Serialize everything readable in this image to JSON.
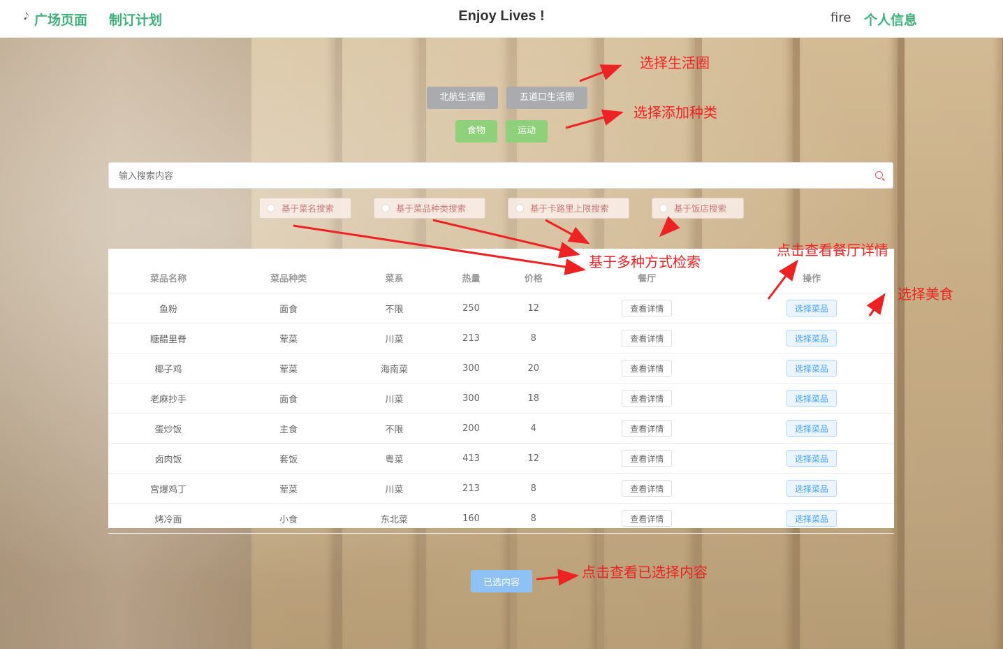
{
  "nav": {
    "plaza_label": "广场页面",
    "plan_label": "制订计划",
    "brand": "Enjoy Lives !",
    "username": "fire",
    "profile_label": "个人信息"
  },
  "circles": [
    {
      "label": "北航生活圈"
    },
    {
      "label": "五道口生活圈"
    }
  ],
  "categories": [
    {
      "label": "食物"
    },
    {
      "label": "运动"
    }
  ],
  "search": {
    "placeholder": "输入搜索内容"
  },
  "search_modes": [
    {
      "label": "基于菜名搜索"
    },
    {
      "label": "基于菜品种类搜索"
    },
    {
      "label": "基于卡路里上限搜索"
    },
    {
      "label": "基于饭店搜索"
    }
  ],
  "table": {
    "headers": [
      "菜品名称",
      "菜品种类",
      "菜系",
      "热量",
      "价格",
      "餐厅",
      "操作"
    ],
    "detail_label": "查看详情",
    "select_label": "选择菜品",
    "rows": [
      [
        "鱼粉",
        "面食",
        "不限",
        "250",
        "12"
      ],
      [
        "糖醋里脊",
        "荤菜",
        "川菜",
        "213",
        "8"
      ],
      [
        "椰子鸡",
        "荤菜",
        "海南菜",
        "300",
        "20"
      ],
      [
        "老麻抄手",
        "面食",
        "川菜",
        "300",
        "18"
      ],
      [
        "蛋炒饭",
        "主食",
        "不限",
        "200",
        "4"
      ],
      [
        "卤肉饭",
        "套饭",
        "粤菜",
        "413",
        "12"
      ],
      [
        "宫爆鸡丁",
        "荤菜",
        "川菜",
        "213",
        "8"
      ],
      [
        "烤冷面",
        "小食",
        "东北菜",
        "160",
        "8"
      ]
    ]
  },
  "selected_button_label": "已选内容",
  "annotations": {
    "circle": "选择生活圈",
    "category": "选择添加种类",
    "search_modes": "基于多种方式检索",
    "detail": "点击查看餐厅详情",
    "select": "选择美食",
    "selected": "点击查看已选择内容"
  },
  "colors": {
    "nav_green": "#3fb07c",
    "annotation_red": "#ee2222",
    "chip_gray": "#a9abaf",
    "chip_green": "#8fd07a",
    "primary_blue": "#409eff"
  }
}
